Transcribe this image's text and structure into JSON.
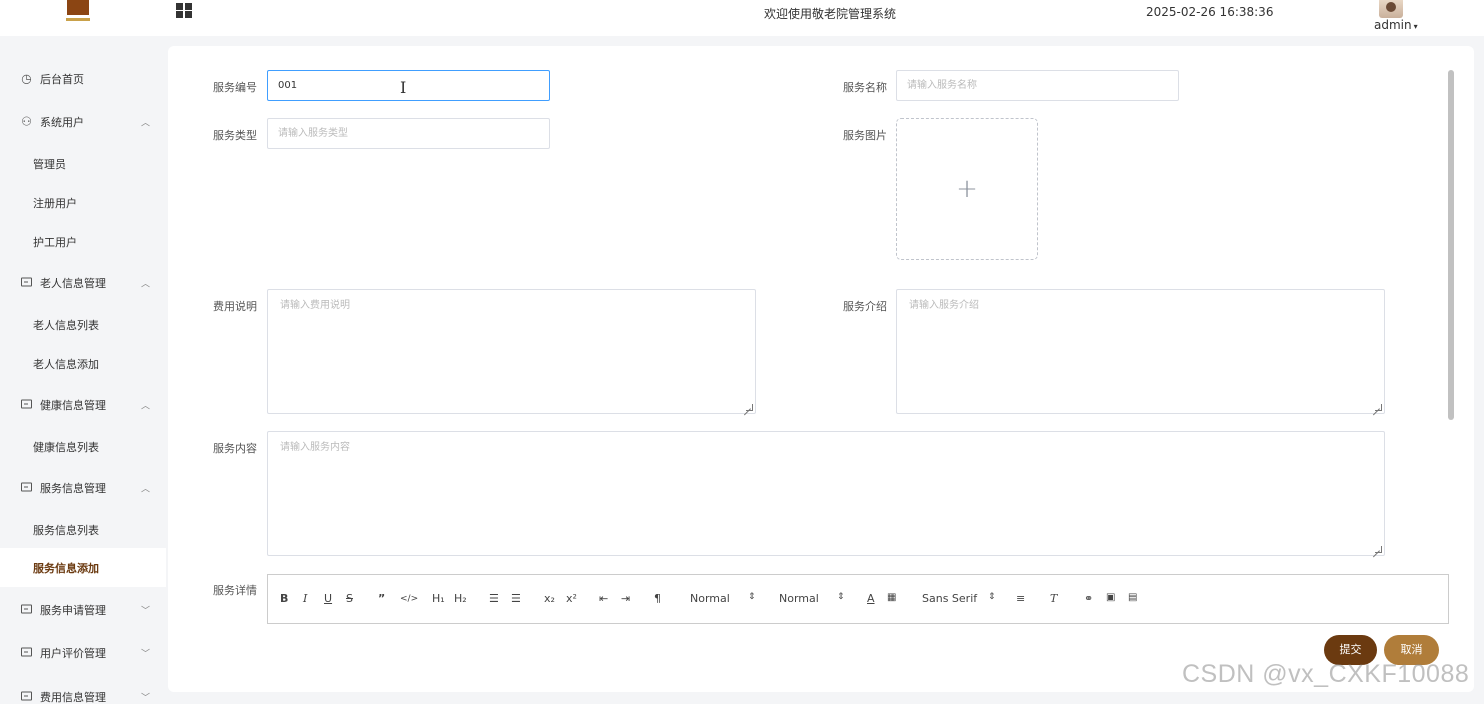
{
  "header": {
    "title": "欢迎使用敬老院管理系统",
    "datetime": "2025-02-26 16:38:36",
    "user": "admin"
  },
  "sidebar": {
    "items": [
      {
        "type": "top",
        "label": "后台首页",
        "icon": "clock-icon"
      },
      {
        "type": "group",
        "label": "系统用户",
        "icon": "user-icon",
        "expanded": true
      },
      {
        "type": "sub",
        "label": "管理员"
      },
      {
        "type": "sub",
        "label": "注册用户"
      },
      {
        "type": "sub",
        "label": "护工用户"
      },
      {
        "type": "group",
        "label": "老人信息管理",
        "icon": "card-icon",
        "expanded": true
      },
      {
        "type": "sub",
        "label": "老人信息列表"
      },
      {
        "type": "sub",
        "label": "老人信息添加"
      },
      {
        "type": "group",
        "label": "健康信息管理",
        "icon": "card-icon",
        "expanded": true
      },
      {
        "type": "sub",
        "label": "健康信息列表"
      },
      {
        "type": "group",
        "label": "服务信息管理",
        "icon": "card-icon",
        "expanded": true
      },
      {
        "type": "sub",
        "label": "服务信息列表"
      },
      {
        "type": "sub",
        "label": "服务信息添加",
        "active": true
      },
      {
        "type": "group",
        "label": "服务申请管理",
        "icon": "card-icon",
        "expanded": false
      },
      {
        "type": "group",
        "label": "用户评价管理",
        "icon": "card-icon",
        "expanded": false
      },
      {
        "type": "group",
        "label": "费用信息管理",
        "icon": "card-icon",
        "expanded": false
      }
    ]
  },
  "form": {
    "service_no": {
      "label": "服务编号",
      "value": "001"
    },
    "service_name": {
      "label": "服务名称",
      "placeholder": "请输入服务名称"
    },
    "service_type": {
      "label": "服务类型",
      "placeholder": "请输入服务类型"
    },
    "service_image": {
      "label": "服务图片"
    },
    "fee_desc": {
      "label": "费用说明",
      "placeholder": "请输入费用说明"
    },
    "service_intro": {
      "label": "服务介绍",
      "placeholder": "请输入服务介绍"
    },
    "service_content": {
      "label": "服务内容",
      "placeholder": "请输入服务内容"
    },
    "service_detail": {
      "label": "服务详情"
    }
  },
  "toolbar": {
    "header1_select": "Normal",
    "size_select": "Normal",
    "font_select": "Sans Serif"
  },
  "buttons": {
    "submit": "提交",
    "cancel": "取消"
  },
  "watermark": "CSDN @vx_CXKF10088",
  "colors": {
    "brand": "#6b3a10",
    "secondary": "#b07d3a",
    "focus": "#409eff"
  }
}
